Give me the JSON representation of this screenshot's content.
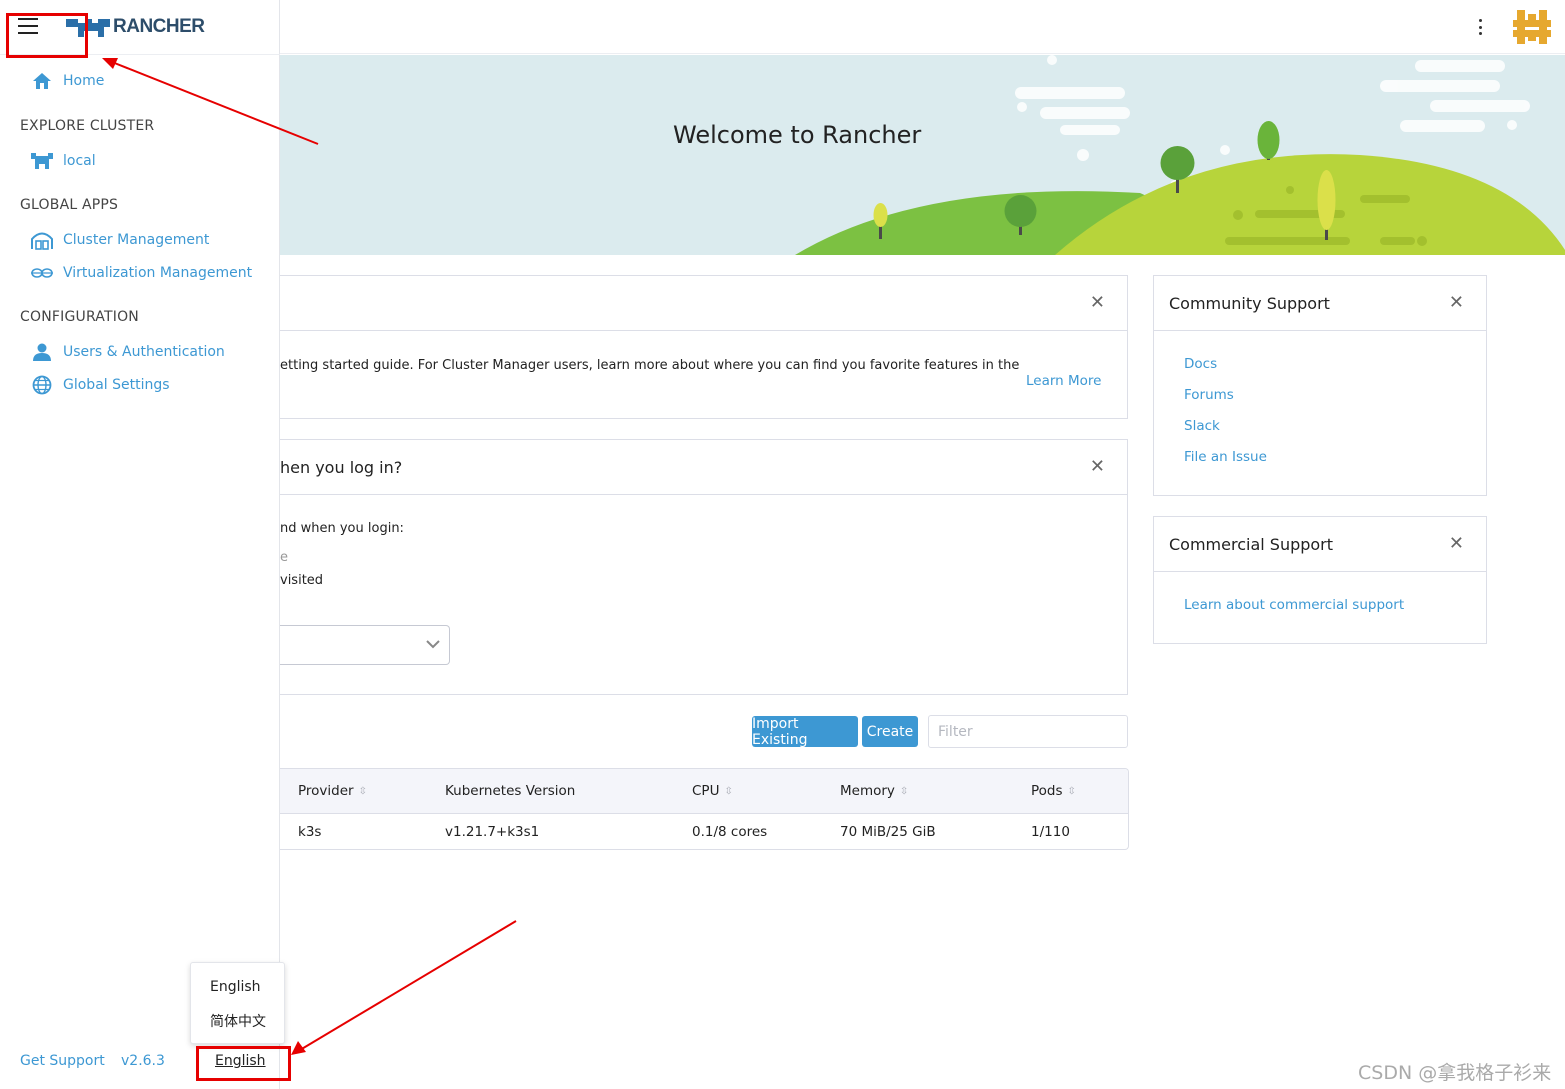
{
  "banner": {
    "title": "Welcome to Rancher"
  },
  "sidebar": {
    "home": {
      "label": "Home",
      "icon": "home-icon"
    },
    "sections": [
      {
        "title": "EXPLORE CLUSTER",
        "items": [
          {
            "label": "local",
            "icon": "cluster-cow-icon"
          }
        ]
      },
      {
        "title": "GLOBAL APPS",
        "items": [
          {
            "label": "Cluster Management",
            "icon": "cluster-management-icon"
          },
          {
            "label": "Virtualization Management",
            "icon": "virtualization-icon"
          }
        ]
      },
      {
        "title": "CONFIGURATION",
        "items": [
          {
            "label": "Users & Authentication",
            "icon": "user-icon"
          },
          {
            "label": "Global Settings",
            "icon": "globe-icon"
          }
        ]
      }
    ],
    "footer": {
      "support": "Get Support",
      "version": "v2.6.3",
      "language": "English"
    },
    "language_menu": {
      "options": [
        "English",
        "简体中文"
      ]
    }
  },
  "logo": {
    "text": "RANCHER"
  },
  "getting_started": {
    "text": "etting started guide. For Cluster Manager users, learn more about where you can find you favorite features in the",
    "learn_more": "Learn More"
  },
  "login_card": {
    "title": "hen you log in?",
    "prompt": "nd when you login:",
    "option_1": "e",
    "option_2": "visited"
  },
  "community_support": {
    "title": "Community Support",
    "links": [
      "Docs",
      "Forums",
      "Slack",
      "File an Issue"
    ]
  },
  "commercial_support": {
    "title": "Commercial Support",
    "link": "Learn about commercial support"
  },
  "clusters": {
    "import_button": "Import Existing",
    "create_button": "Create",
    "filter_placeholder": "Filter",
    "columns": [
      "Provider",
      "Kubernetes Version",
      "CPU",
      "Memory",
      "Pods"
    ],
    "rows": [
      {
        "provider": "k3s",
        "version": "v1.21.7+k3s1",
        "cpu": "0.1/8 cores",
        "memory": "70 MiB/25 GiB",
        "pods": "1/110"
      }
    ]
  },
  "watermark": "CSDN @拿我格子衫来",
  "colors": {
    "link": "#3d98d3",
    "button": "#3d98d3",
    "annotation": "#e60000",
    "hill_light": "#b7d43b",
    "hill_dark": "#7cc142"
  }
}
